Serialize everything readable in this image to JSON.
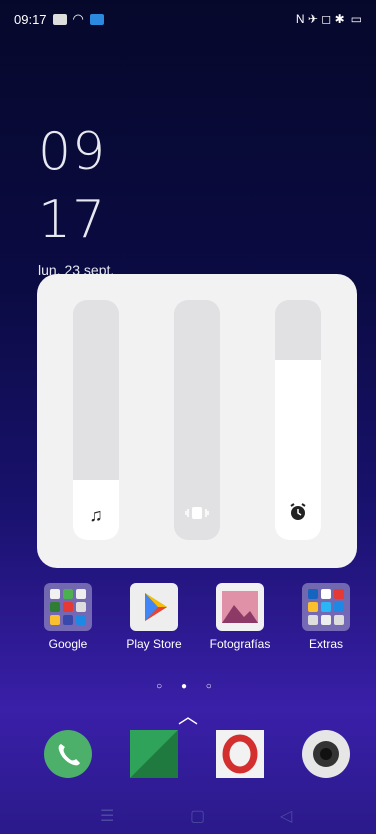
{
  "status": {
    "time": "09:17",
    "right_icons": "N  ✈  ◻  ✱"
  },
  "clock": {
    "hour": "09",
    "minute": "17"
  },
  "date": "lun. 23 sept.",
  "volume": {
    "media": {
      "level": 0.25,
      "icon": "music-note-icon"
    },
    "ring": {
      "level": 0.0,
      "icon": "vibrate-icon"
    },
    "alarm": {
      "level": 0.75,
      "icon": "alarm-icon"
    }
  },
  "apps": [
    {
      "label": "Google"
    },
    {
      "label": "Play Store"
    },
    {
      "label": "Fotografías"
    },
    {
      "label": "Extras"
    }
  ],
  "dock": [
    "phone-icon",
    "messages-icon",
    "opera-icon",
    "camera-icon"
  ],
  "page_dots": "○ ● ○",
  "colors": {
    "panel": "#f2f2f3",
    "phone": "#4caf6a",
    "messages": "#2fa35a",
    "opera": "#d32f2f"
  }
}
